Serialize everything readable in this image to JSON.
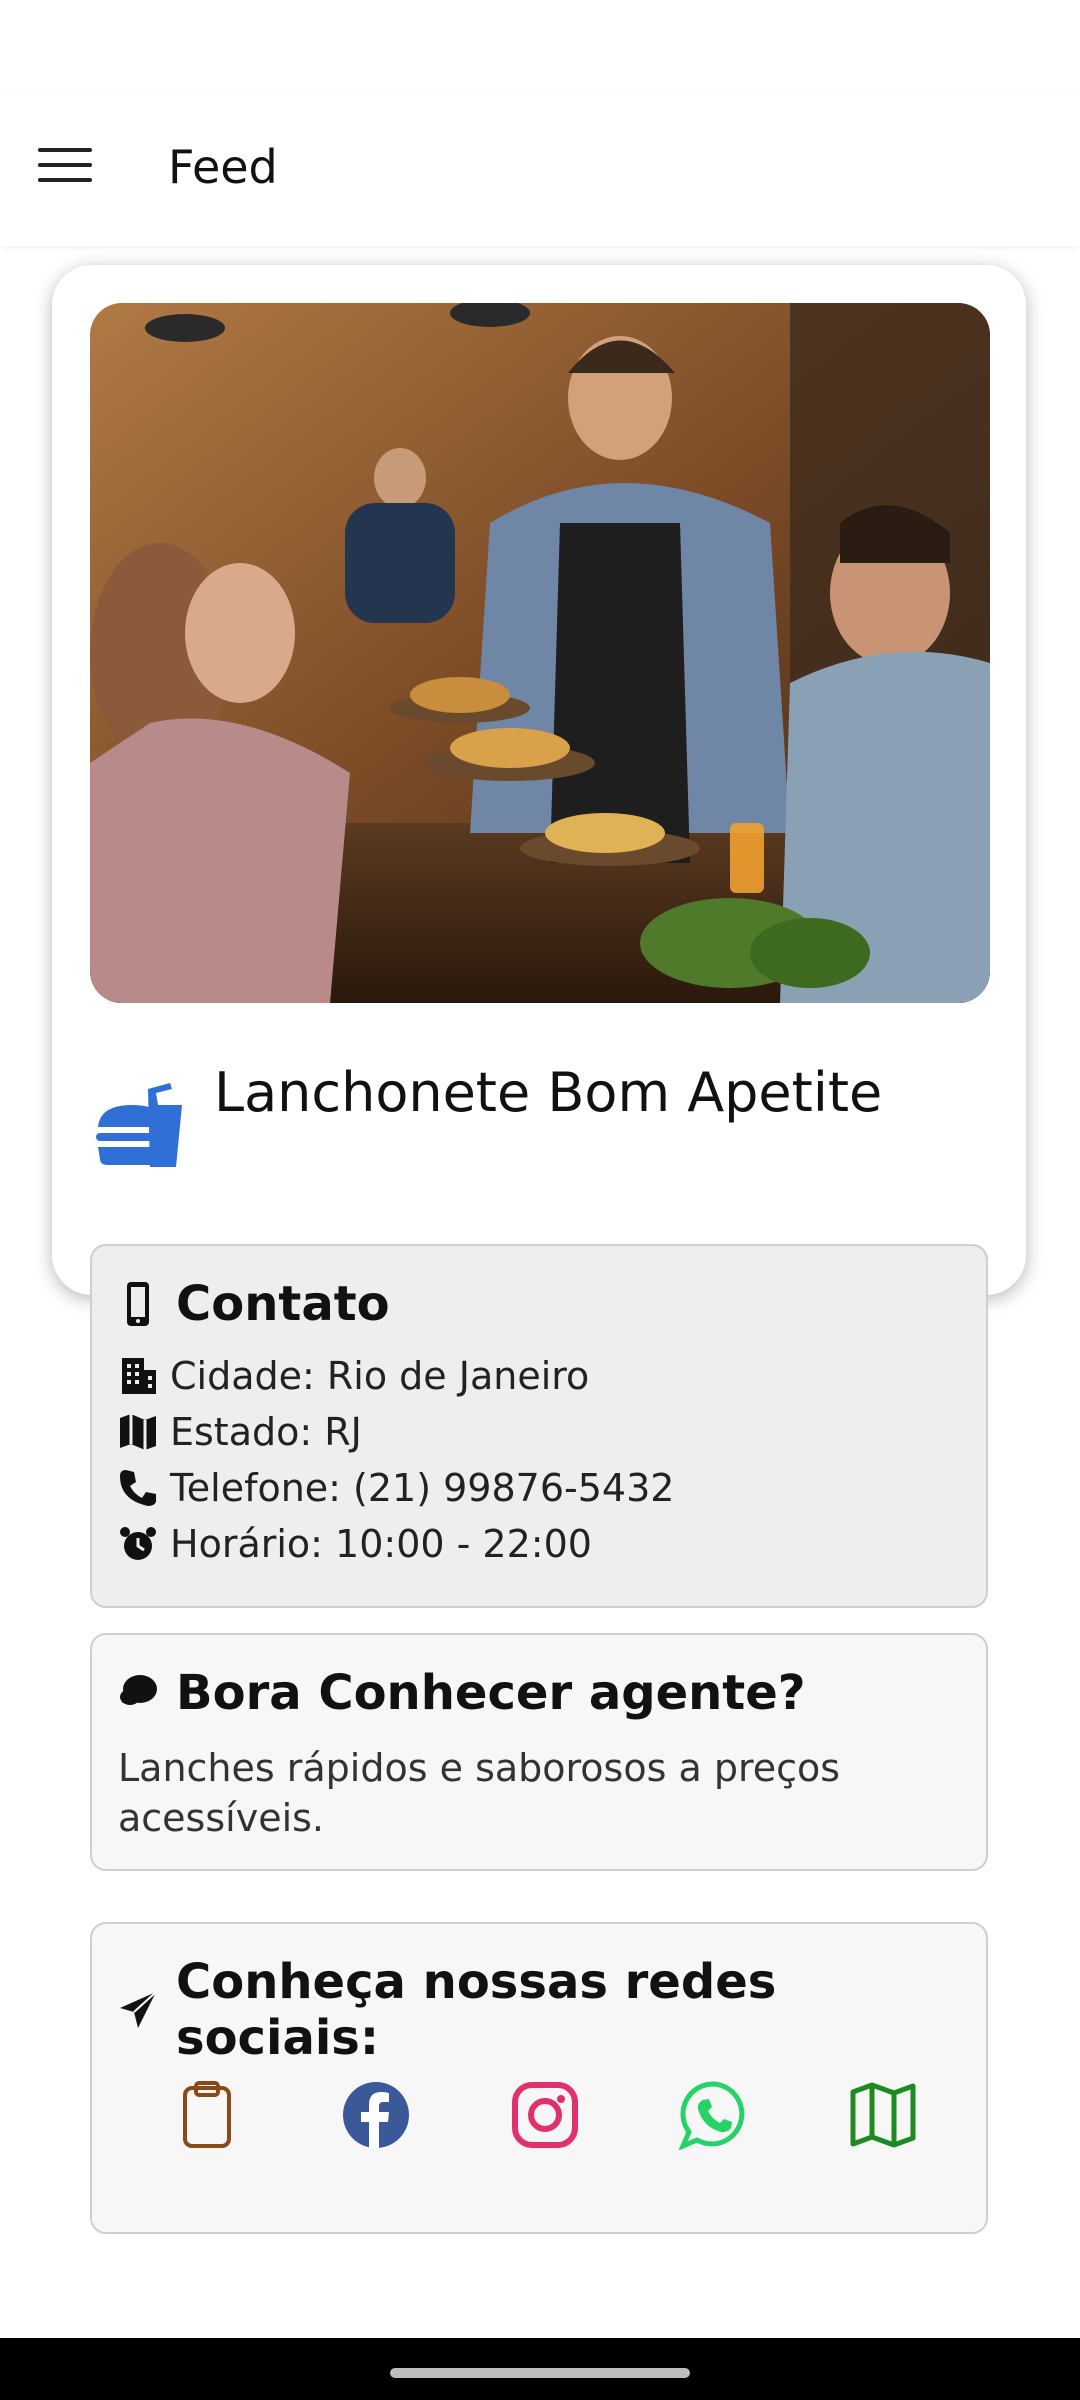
{
  "app_bar": {
    "title": "Feed",
    "menu_icon": "hamburger-menu-icon"
  },
  "store": {
    "name": "Lanchonete Bom Apetite",
    "icon": "burger-soda-icon",
    "image_alt": "Garçom servindo hambúrgueres e batatas fritas a clientes em um restaurante",
    "accent_color": "#2f6fd6"
  },
  "contact": {
    "title": "Contato",
    "title_icon": "mobile-phone-icon",
    "items": [
      {
        "icon": "building-icon",
        "text": "Cidade: Rio de Janeiro"
      },
      {
        "icon": "map-icon",
        "text": "Estado: RJ"
      },
      {
        "icon": "phone-icon",
        "text": "Telefone: (21) 99876-5432"
      },
      {
        "icon": "alarm-clock-icon",
        "text": "Horário: 10:00 - 22:00"
      }
    ]
  },
  "about": {
    "title": "Bora Conhecer agente?",
    "title_icon": "chat-bubble-icon",
    "text": "Lanches rápidos e saborosos a preços acessíveis."
  },
  "social": {
    "title": "Conheça nossas redes sociais:",
    "title_icon": "paper-plane-icon",
    "icons": [
      {
        "name": "clipboard-icon",
        "color": "#8a4a16"
      },
      {
        "name": "facebook-icon",
        "color": "#3b5998"
      },
      {
        "name": "instagram-icon",
        "color": "#e1306c"
      },
      {
        "name": "whatsapp-icon",
        "color": "#25d366"
      },
      {
        "name": "map-icon",
        "color": "#1f8a1f"
      }
    ]
  }
}
